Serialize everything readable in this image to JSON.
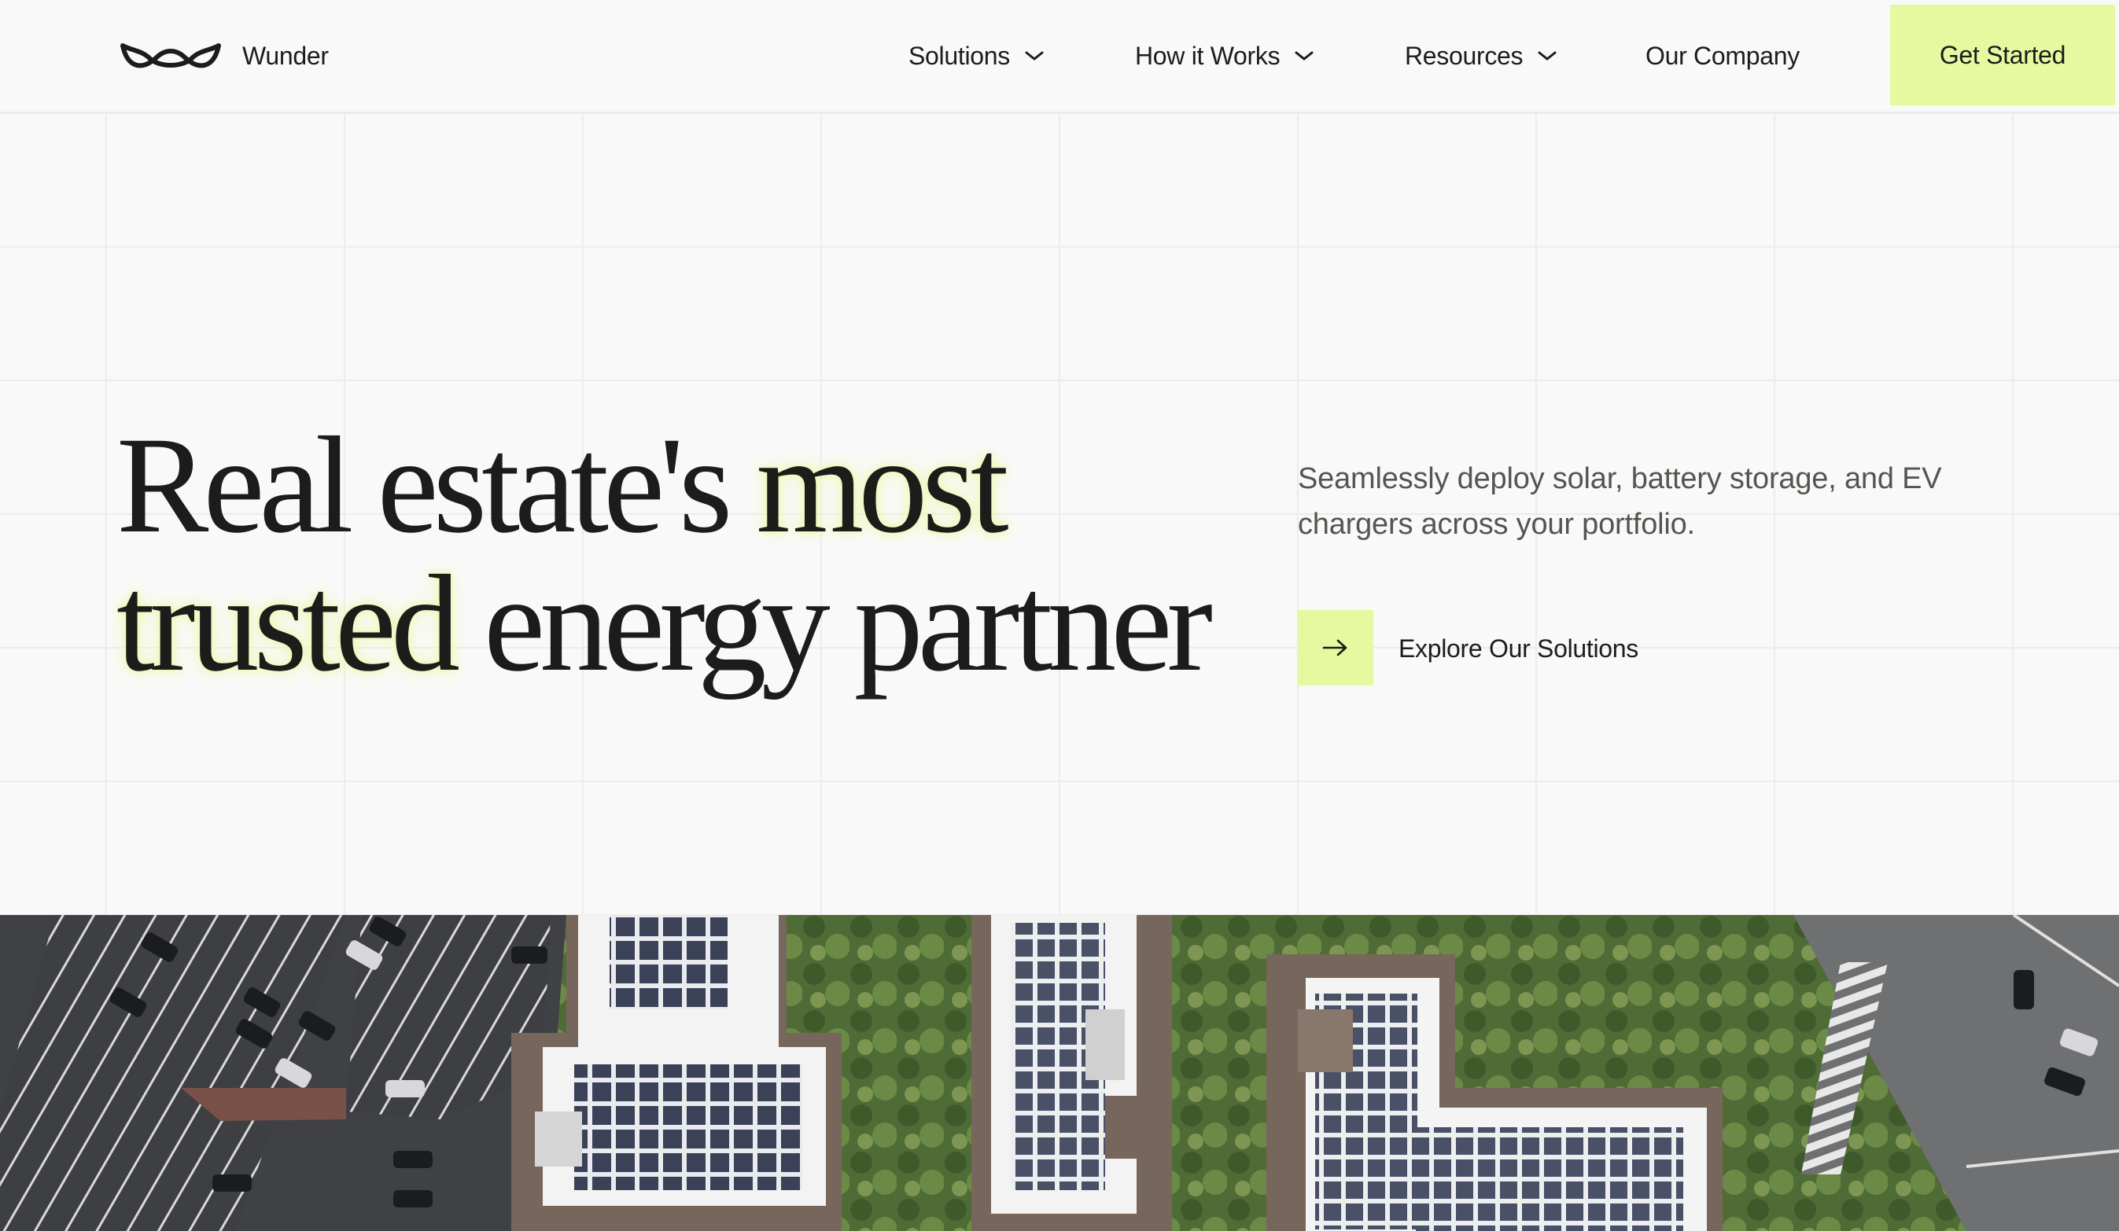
{
  "brand": {
    "name": "Wunder",
    "logo_icon": "infinity-wave-icon",
    "accent_color": "#e6f9a0",
    "text_color": "#1c1c1a",
    "background_color": "#f9f9f9"
  },
  "nav": {
    "items": [
      {
        "label": "Solutions",
        "has_dropdown": true
      },
      {
        "label": "How it Works",
        "has_dropdown": true
      },
      {
        "label": "Resources",
        "has_dropdown": true
      },
      {
        "label": "Our Company",
        "has_dropdown": false
      }
    ],
    "cta_label": "Get Started"
  },
  "hero": {
    "headline_part1": "Real estate's ",
    "headline_highlight1": "most",
    "headline_highlight2": "trusted",
    "headline_part2": " energy partner",
    "subtext": "Seamlessly deploy solar, battery storage, and EV chargers across your portfolio.",
    "cta_icon": "arrow-right-icon",
    "cta_label": "Explore Our Solutions"
  },
  "media": {
    "description_icon": "aerial-solar-rooftops-image"
  }
}
